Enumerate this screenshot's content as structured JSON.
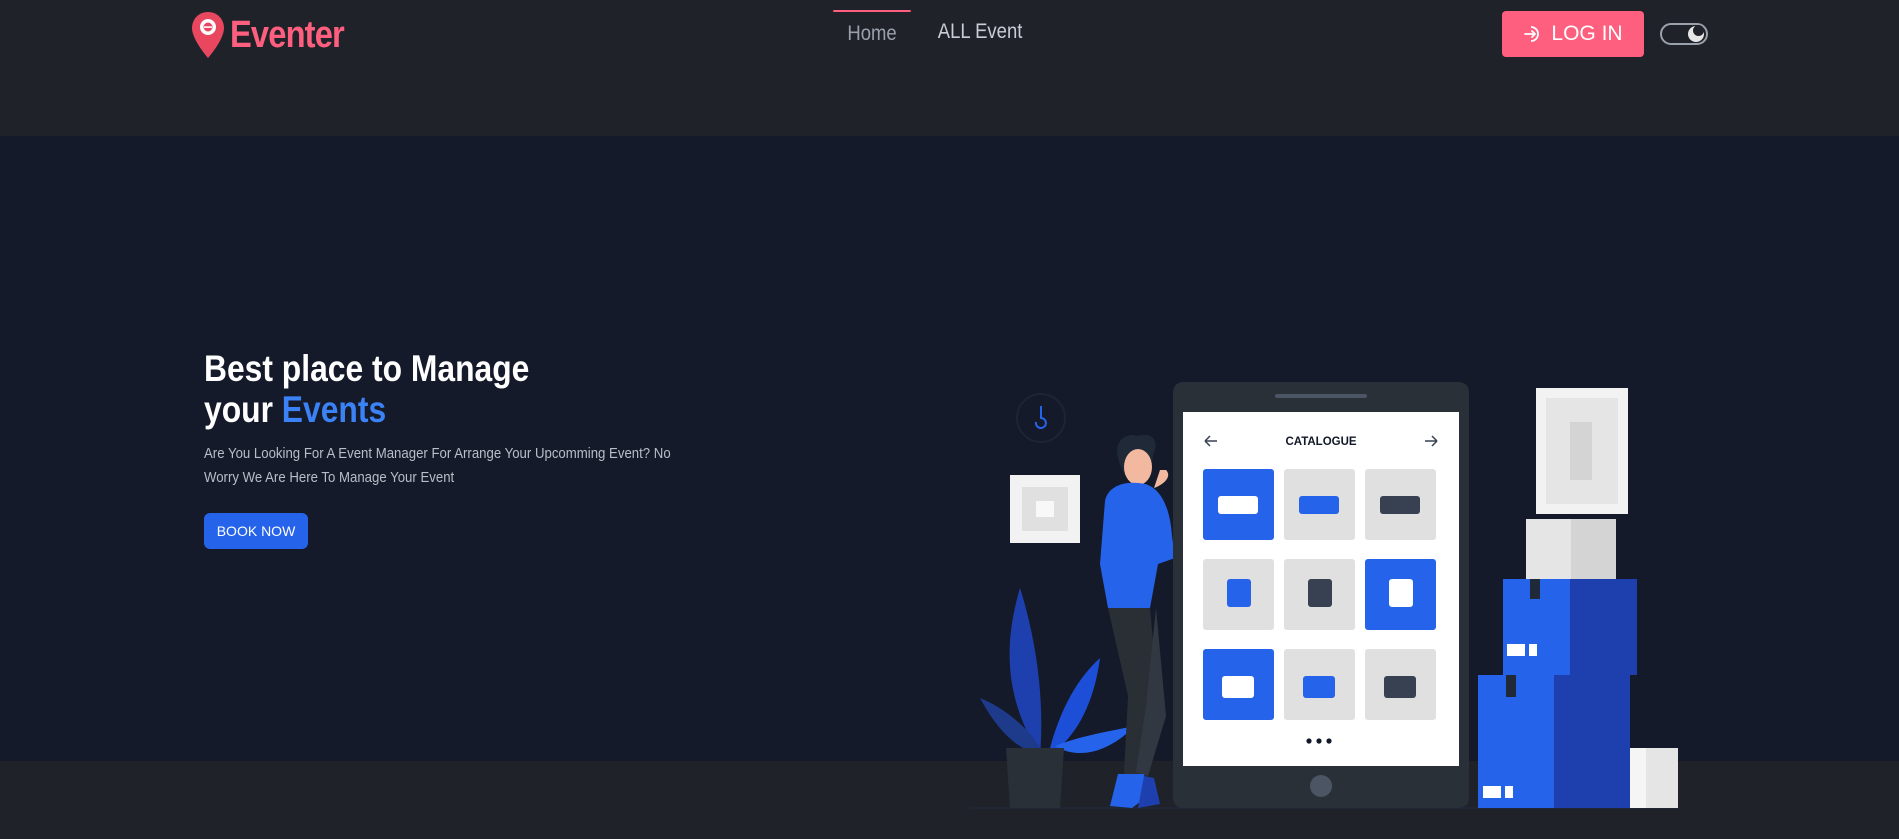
{
  "brand": {
    "name": "Eventer"
  },
  "nav": {
    "items": [
      {
        "label": "Home",
        "active": true
      },
      {
        "label": "ALL Event",
        "active": false
      }
    ]
  },
  "header": {
    "login_label": "LOG IN"
  },
  "theme_toggle": {
    "mode": "dark"
  },
  "hero": {
    "title_line1": "Best place to Manage",
    "title_line2_prefix": "your",
    "title_line2_accent": "Events",
    "description": "Are You Looking For A Event Manager For Arrange Your Upcomming Event? No Worry We Are Here To Manage Your Event",
    "cta_label": "BOOK NOW",
    "illustration": {
      "catalogue_title": "CATALOGUE"
    }
  },
  "colors": {
    "accent": "#ff5f7e",
    "primary": "#2563eb",
    "hero_bg": "#141a29",
    "nav_bg": "#1f2329"
  }
}
